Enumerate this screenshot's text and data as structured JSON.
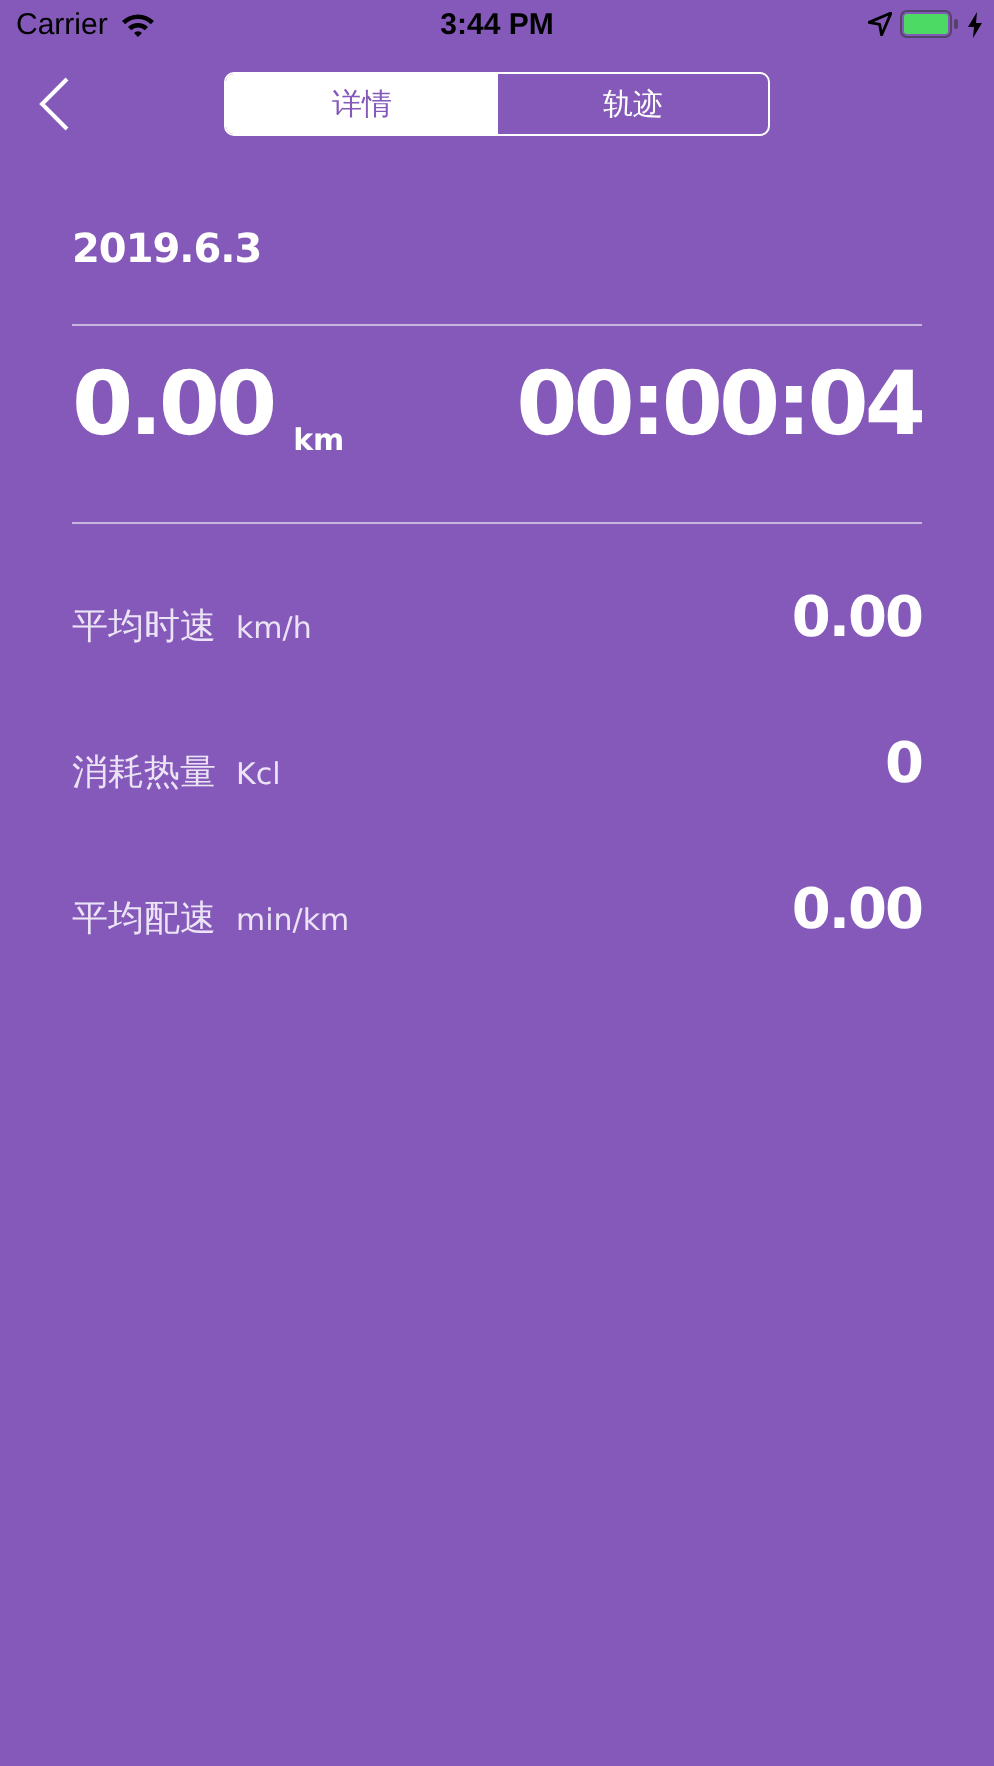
{
  "status_bar": {
    "carrier": "Carrier",
    "time": "3:44 PM"
  },
  "tabs": [
    {
      "label": "详情",
      "selected": true
    },
    {
      "label": "轨迹",
      "selected": false
    }
  ],
  "date": "2019.6.3",
  "summary": {
    "distance": "0.00",
    "distance_unit": "km",
    "duration": "00:00:04"
  },
  "stats": [
    {
      "label": "平均时速",
      "unit": "km/h",
      "value": "0.00"
    },
    {
      "label": "消耗热量",
      "unit": "Kcl",
      "value": "0"
    },
    {
      "label": "平均配速",
      "unit": "min/km",
      "value": "0.00"
    }
  ]
}
